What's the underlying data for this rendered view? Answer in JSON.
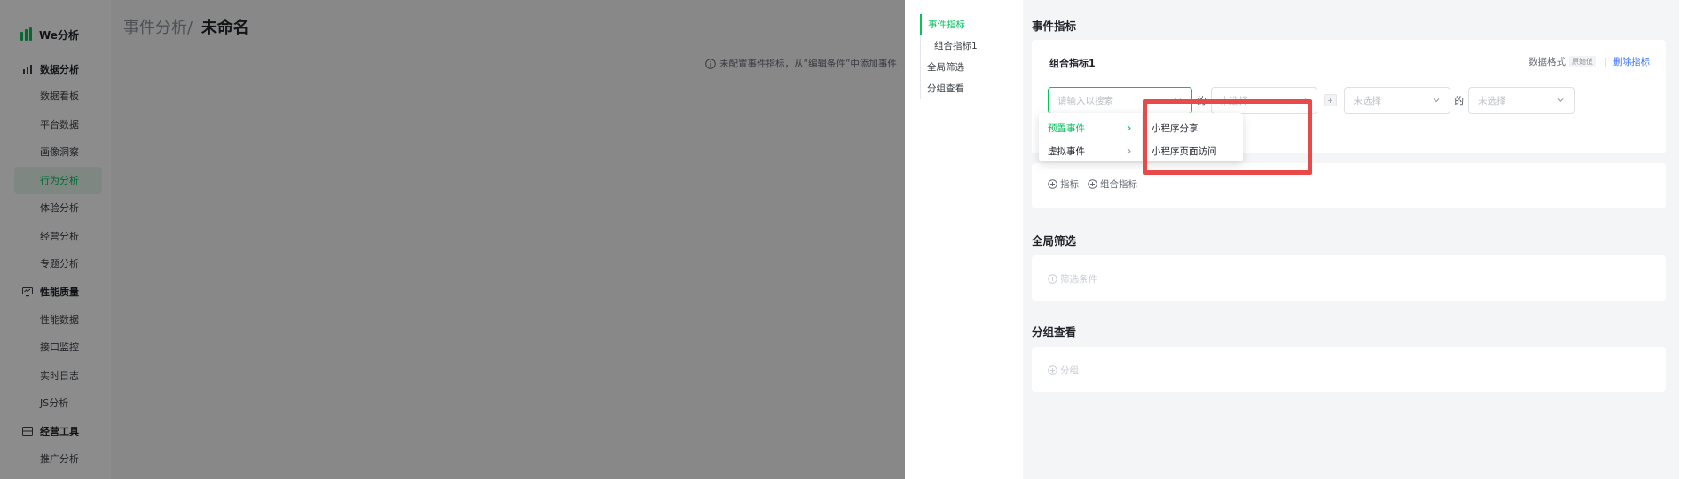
{
  "app": {
    "name": "We分析"
  },
  "sidebar": {
    "groups": [
      {
        "label": "数据分析",
        "icon": "bar-chart-icon",
        "items": [
          "数据看板",
          "平台数据",
          "画像洞察",
          "行为分析",
          "体验分析",
          "经营分析",
          "专题分析"
        ],
        "active": "行为分析"
      },
      {
        "label": "性能质量",
        "icon": "monitor-icon",
        "items": [
          "性能数据",
          "接口监控",
          "实时日志",
          "JS分析"
        ]
      },
      {
        "label": "经营工具",
        "icon": "tools-icon",
        "items": [
          "推广分析"
        ]
      }
    ]
  },
  "main": {
    "breadcrumb_parent": "事件分析",
    "breadcrumb_sep": "/",
    "title": "未命名",
    "hint": "未配置事件指标，从“编辑条件”中添加事件"
  },
  "drawer": {
    "anchors": [
      "事件指标",
      "组合指标1",
      "全局筛选",
      "分组查看"
    ],
    "section_event": "事件指标",
    "metric": {
      "name": "组合指标1",
      "format_label": "数据格式",
      "format_tag": "原始值",
      "delete_label": "删除指标",
      "search_placeholder": "请输入以搜索",
      "of_word": "的",
      "second_select": "未选择",
      "operator": "+",
      "third_select": "未选择",
      "of_word2": "的",
      "fourth_select": "未选择"
    },
    "dropdown": {
      "categories": [
        "预置事件",
        "虚拟事件"
      ],
      "active_category": "预置事件",
      "events": [
        "小程序分享",
        "小程序页面访问"
      ]
    },
    "add": {
      "metric": "指标",
      "combo_metric": "组合指标"
    },
    "section_filter": "全局筛选",
    "filter_add": "筛选条件",
    "section_group": "分组查看",
    "group_add": "分组"
  },
  "colors": {
    "accent": "#07c160",
    "link": "#3370ff",
    "highlight": "#e84a4a"
  }
}
